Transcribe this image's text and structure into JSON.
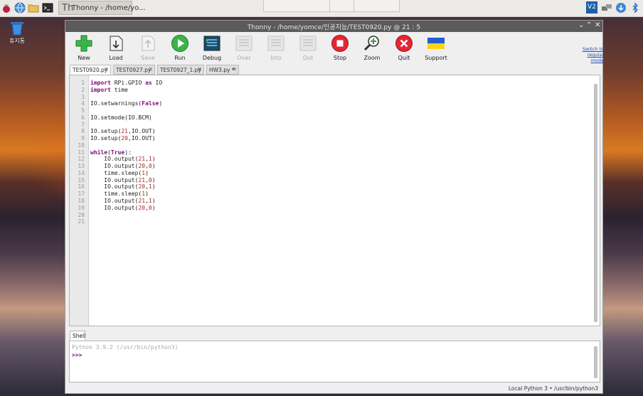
{
  "taskbar": {
    "app_title": "Thonny - /home/yo...",
    "tray_badge": "V2"
  },
  "desktop": {
    "trash_label": "휴지통"
  },
  "window": {
    "title": "Thonny - /home/yomce/인공지능/TEST0920.py @ 21 : 5",
    "switch_mode": "Switch to regular mode"
  },
  "toolbar": [
    {
      "label": "New",
      "icon": "new-file-icon",
      "enabled": true
    },
    {
      "label": "Load",
      "icon": "load-file-icon",
      "enabled": true
    },
    {
      "label": "Save",
      "icon": "save-icon",
      "enabled": false
    },
    {
      "label": "Run",
      "icon": "run-icon",
      "enabled": true
    },
    {
      "label": "Debug",
      "icon": "debug-icon",
      "enabled": true
    },
    {
      "label": "Over",
      "icon": "step-over-icon",
      "enabled": false
    },
    {
      "label": "Into",
      "icon": "step-into-icon",
      "enabled": false
    },
    {
      "label": "Out",
      "icon": "step-out-icon",
      "enabled": false
    },
    {
      "label": "Stop",
      "icon": "stop-icon",
      "enabled": true
    },
    {
      "label": "Zoom",
      "icon": "zoom-icon",
      "enabled": true
    },
    {
      "label": "Quit",
      "icon": "quit-icon",
      "enabled": true
    },
    {
      "label": "Support",
      "icon": "ukraine-flag-icon",
      "enabled": true
    }
  ],
  "tabs": [
    {
      "label": "TEST0920.py",
      "active": true
    },
    {
      "label": "TEST0927.py",
      "active": false
    },
    {
      "label": "TEST0927_1.py",
      "active": false
    },
    {
      "label": "HW3.py *",
      "active": false
    }
  ],
  "editor": {
    "lines": [
      "import RPi.GPIO as IO",
      "import time",
      "",
      "IO.setwarnings(False)",
      "",
      "IO.setmode(IO.BCM)",
      "",
      "IO.setup(21,IO.OUT)",
      "IO.setup(20,IO.OUT)",
      "",
      "while(True):",
      "    IO.output(21,1)",
      "    IO.output(20,0)",
      "    time.sleep(1)",
      "    IO.output(21,0)",
      "    IO.output(20,1)",
      "    time.sleep(1)",
      "    IO.output(21,1)",
      "    IO.output(20,0)",
      "",
      ""
    ]
  },
  "shell": {
    "tab_label": "Shell",
    "version_line": "Python 3.9.2 (/usr/bin/python3)",
    "prompt": ">>>"
  },
  "status": {
    "interpreter": "Local Python 3 • /usr/bin/python3"
  },
  "colors": {
    "keyword": "#7a0a75",
    "number": "#b3261e",
    "titlebar": "#5b5b5b"
  }
}
